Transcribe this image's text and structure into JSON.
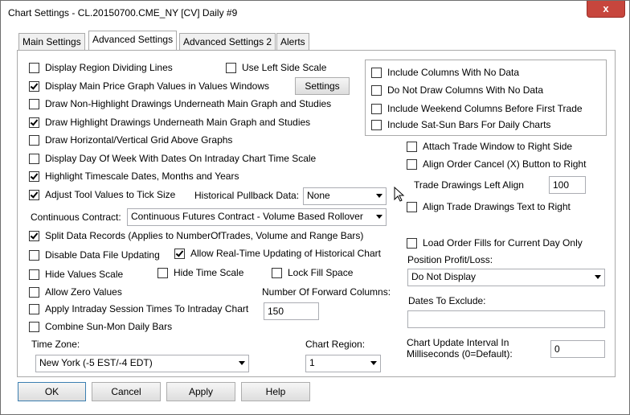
{
  "window": {
    "title": "Chart Settings - CL.20150700.CME_NY [CV]  Daily  #9",
    "close_glyph": "x"
  },
  "tabs": [
    {
      "label": "Main Settings"
    },
    {
      "label": "Advanced Settings",
      "active": true
    },
    {
      "label": "Advanced Settings 2"
    },
    {
      "label": "Alerts"
    }
  ],
  "left": {
    "display_region_dividing_lines": {
      "label": "Display Region Dividing Lines",
      "checked": false
    },
    "use_left_side_scale": {
      "label": "Use Left Side Scale",
      "checked": false
    },
    "display_main_price_values": {
      "label": "Display Main Price Graph Values in Values Windows",
      "checked": true
    },
    "settings_button": "Settings",
    "draw_non_highlight_underneath": {
      "label": "Draw Non-Highlight Drawings Underneath Main Graph and Studies",
      "checked": false
    },
    "draw_highlight_underneath": {
      "label": "Draw Highlight Drawings Underneath Main Graph and Studies",
      "checked": true
    },
    "draw_grid_above": {
      "label": "Draw Horizontal/Vertical Grid Above Graphs",
      "checked": false
    },
    "display_day_of_week": {
      "label": "Display Day Of Week With Dates On Intraday Chart Time Scale",
      "checked": false
    },
    "highlight_timescale_dates": {
      "label": "Highlight Timescale Dates, Months and Years",
      "checked": true
    },
    "adjust_tool_values": {
      "label": "Adjust Tool Values to Tick Size",
      "checked": true
    },
    "historical_pullback_label": "Historical Pullback Data:",
    "historical_pullback_value": "None",
    "continuous_contract_label": "Continuous Contract:",
    "continuous_contract_value": "Continuous Futures Contract - Volume Based Rollover",
    "split_data_records": {
      "label": "Split Data Records (Applies to NumberOfTrades, Volume and Range Bars)",
      "checked": true
    },
    "disable_data_file_updating": {
      "label": "Disable Data File Updating",
      "checked": false
    },
    "allow_realtime_updating": {
      "label": "Allow Real-Time Updating of Historical Chart",
      "checked": true
    },
    "hide_values_scale": {
      "label": "Hide Values Scale",
      "checked": false
    },
    "hide_time_scale": {
      "label": "Hide Time Scale",
      "checked": false
    },
    "lock_fill_space": {
      "label": "Lock Fill Space",
      "checked": false
    },
    "allow_zero_values": {
      "label": "Allow Zero Values",
      "checked": false
    },
    "forward_columns_label": "Number Of Forward Columns:",
    "forward_columns_value": "150",
    "apply_intraday_session_times": {
      "label": "Apply Intraday Session Times To Intraday Chart",
      "checked": false
    },
    "combine_sun_mon": {
      "label": "Combine Sun-Mon Daily Bars",
      "checked": false
    },
    "time_zone_label": "Time Zone:",
    "time_zone_value": "New York (-5 EST/-4 EDT)",
    "chart_region_label": "Chart Region:",
    "chart_region_value": "1"
  },
  "right": {
    "include_columns_no_data": {
      "label": "Include Columns With No Data",
      "checked": false
    },
    "do_not_draw_columns": {
      "label": "Do Not Draw Columns With No Data",
      "checked": false
    },
    "include_weekend_columns": {
      "label": "Include Weekend Columns Before First Trade",
      "checked": false
    },
    "include_sat_sun_bars": {
      "label": "Include Sat-Sun Bars For Daily Charts",
      "checked": false
    },
    "attach_trade_window": {
      "label": "Attach Trade Window to Right Side",
      "checked": false
    },
    "align_order_cancel": {
      "label": "Align Order Cancel (X) Button to Right",
      "checked": false
    },
    "trade_drawings_left_align_label": "Trade Drawings Left Align",
    "trade_drawings_left_align_value": "100",
    "align_trade_drawings_text": {
      "label": "Align Trade Drawings Text to Right",
      "checked": false
    },
    "load_order_fills": {
      "label": "Load Order Fills for Current Day Only",
      "checked": false
    },
    "position_profit_loss_label": "Position Profit/Loss:",
    "position_profit_loss_value": "Do Not Display",
    "dates_to_exclude_label": "Dates To Exclude:",
    "dates_to_exclude_value": "",
    "chart_update_interval_label_line1": "Chart Update Interval In",
    "chart_update_interval_label_line2": "Milliseconds (0=Default):",
    "chart_update_interval_value": "0"
  },
  "footer": {
    "ok": "OK",
    "cancel": "Cancel",
    "apply": "Apply",
    "help": "Help"
  }
}
